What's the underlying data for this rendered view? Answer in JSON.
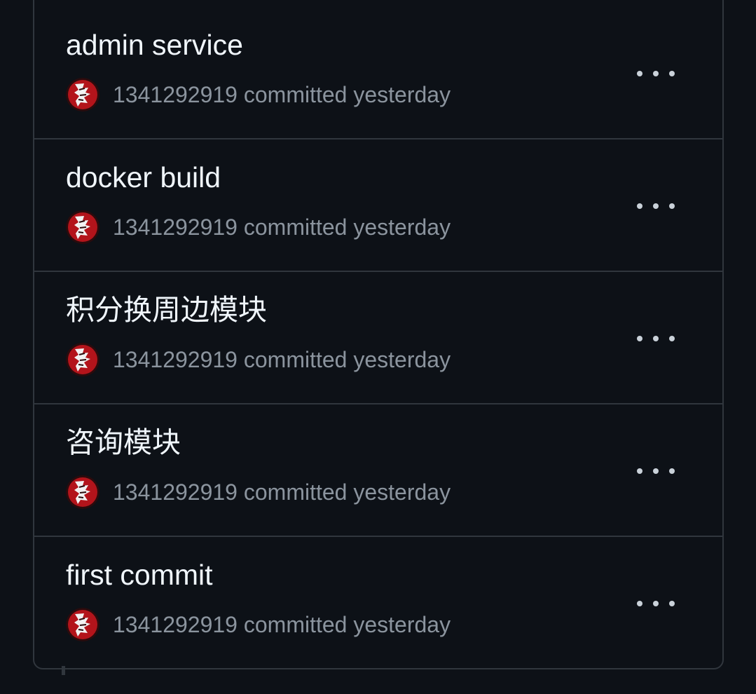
{
  "commits": [
    {
      "message": "admin service",
      "author": "1341292919",
      "meta": "1341292919 committed yesterday"
    },
    {
      "message": "docker build",
      "author": "1341292919",
      "meta": "1341292919 committed yesterday"
    },
    {
      "message": "积分换周边模块",
      "author": "1341292919",
      "meta": "1341292919 committed yesterday"
    },
    {
      "message": "咨询模块",
      "author": "1341292919",
      "meta": "1341292919 committed yesterday"
    },
    {
      "message": "first commit",
      "author": "1341292919",
      "meta": "1341292919 committed yesterday"
    }
  ],
  "icons": {
    "more": "more-horizontal-icon",
    "avatar": "user-avatar"
  },
  "colors": {
    "background": "#0d1117",
    "border": "#30363d",
    "title": "#f0f6fc",
    "meta": "#8b949e",
    "avatar_red": "#b3141b"
  }
}
